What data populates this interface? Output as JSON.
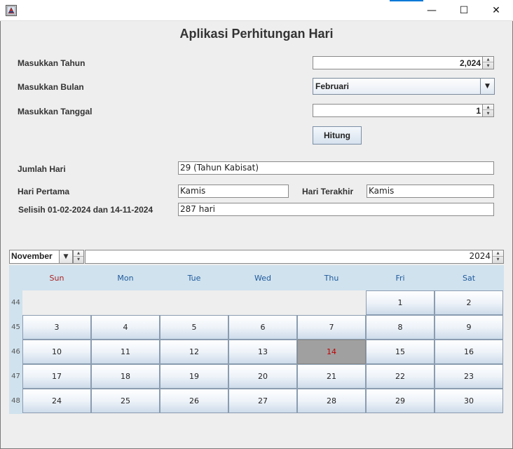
{
  "colors": {
    "accent": "#0078d7",
    "calendar_header": "#d0e2ee",
    "today_bg": "#a0a0a0",
    "today_text": "#c00000",
    "sunday_text": "#aa2222",
    "weekday_text": "#1e5a9c"
  },
  "window": {
    "minimize_glyph": "—",
    "maximize_glyph": "☐",
    "close_glyph": "✕"
  },
  "app_title": "Aplikasi Perhitungan Hari",
  "form": {
    "year_label": "Masukkan Tahun",
    "year_value": "2,024",
    "month_label": "Masukkan Bulan",
    "month_value": "Februari",
    "day_label": "Masukkan Tanggal",
    "day_value": "1",
    "calculate_button": "Hitung"
  },
  "results": {
    "days_label": "Jumlah Hari",
    "days_value": "29 (Tahun Kabisat)",
    "first_day_label": "Hari Pertama",
    "first_day_value": "Kamis",
    "last_day_label": "Hari Terakhir",
    "last_day_value": "Kamis",
    "diff_label": "Selisih 01-02-2024 dan 14-11-2024",
    "diff_value": "287 hari"
  },
  "calendar": {
    "month": "November",
    "year": "2024",
    "day_headers": [
      "Sun",
      "Mon",
      "Tue",
      "Wed",
      "Thu",
      "Fri",
      "Sat"
    ],
    "weeks": [
      {
        "week": "44",
        "days": [
          "",
          "",
          "",
          "",
          "",
          "1",
          "2"
        ]
      },
      {
        "week": "45",
        "days": [
          "3",
          "4",
          "5",
          "6",
          "7",
          "8",
          "9"
        ]
      },
      {
        "week": "46",
        "days": [
          "10",
          "11",
          "12",
          "13",
          "14",
          "15",
          "16"
        ]
      },
      {
        "week": "47",
        "days": [
          "17",
          "18",
          "19",
          "20",
          "21",
          "22",
          "23"
        ]
      },
      {
        "week": "48",
        "days": [
          "24",
          "25",
          "26",
          "27",
          "28",
          "29",
          "30"
        ]
      }
    ],
    "selected_day": "14"
  }
}
